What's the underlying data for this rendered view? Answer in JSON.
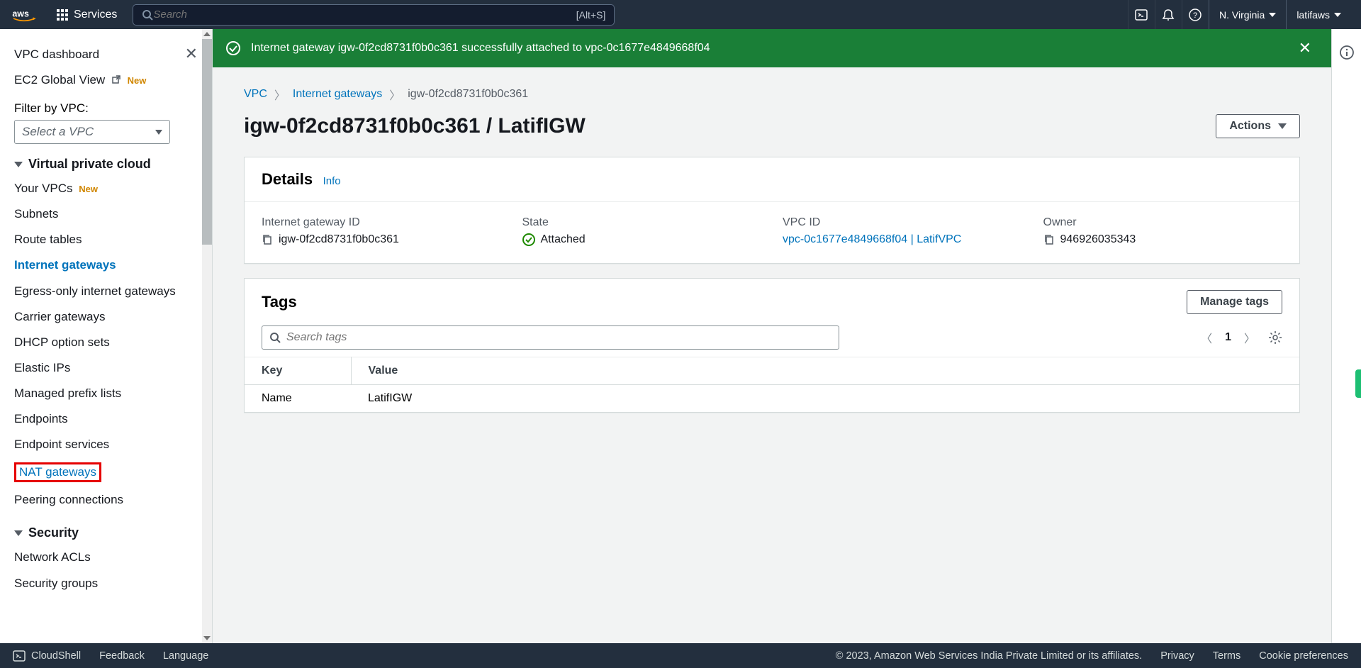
{
  "nav": {
    "services_label": "Services",
    "search_placeholder": "Search",
    "search_hint": "[Alt+S]",
    "region": "N. Virginia",
    "user": "latifaws"
  },
  "sidebar": {
    "dashboard": "VPC dashboard",
    "ec2_global": "EC2 Global View",
    "new_badge": "New",
    "filter_label": "Filter by VPC:",
    "filter_placeholder": "Select a VPC",
    "sections": {
      "vpc_title": "Virtual private cloud",
      "security_title": "Security"
    },
    "vpc_items": [
      {
        "label": "Your VPCs",
        "new": true
      },
      {
        "label": "Subnets"
      },
      {
        "label": "Route tables"
      },
      {
        "label": "Internet gateways",
        "active": true
      },
      {
        "label": "Egress-only internet gateways"
      },
      {
        "label": "Carrier gateways"
      },
      {
        "label": "DHCP option sets"
      },
      {
        "label": "Elastic IPs"
      },
      {
        "label": "Managed prefix lists"
      },
      {
        "label": "Endpoints"
      },
      {
        "label": "Endpoint services"
      },
      {
        "label": "NAT gateways",
        "highlight": true,
        "redbox": true
      },
      {
        "label": "Peering connections"
      }
    ],
    "security_items": [
      {
        "label": "Network ACLs"
      },
      {
        "label": "Security groups"
      }
    ]
  },
  "flash": {
    "message": "Internet gateway igw-0f2cd8731f0b0c361 successfully attached to vpc-0c1677e4849668f04"
  },
  "breadcrumbs": {
    "root": "VPC",
    "mid": "Internet gateways",
    "leaf": "igw-0f2cd8731f0b0c361"
  },
  "page": {
    "title": "igw-0f2cd8731f0b0c361 / LatifIGW",
    "actions_label": "Actions"
  },
  "details": {
    "heading": "Details",
    "info": "Info",
    "igw_id_label": "Internet gateway ID",
    "igw_id": "igw-0f2cd8731f0b0c361",
    "state_label": "State",
    "state": "Attached",
    "vpc_id_label": "VPC ID",
    "vpc_id": "vpc-0c1677e4849668f04 | LatifVPC",
    "owner_label": "Owner",
    "owner": "946926035343"
  },
  "tags": {
    "heading": "Tags",
    "manage_btn": "Manage tags",
    "search_placeholder": "Search tags",
    "page_num": "1",
    "headers": {
      "key": "Key",
      "value": "Value"
    },
    "rows": [
      {
        "key": "Name",
        "value": "LatifIGW"
      }
    ]
  },
  "footer": {
    "cloudshell": "CloudShell",
    "feedback": "Feedback",
    "language": "Language",
    "copyright": "© 2023, Amazon Web Services India Private Limited or its affiliates.",
    "privacy": "Privacy",
    "terms": "Terms",
    "cookies": "Cookie preferences"
  }
}
